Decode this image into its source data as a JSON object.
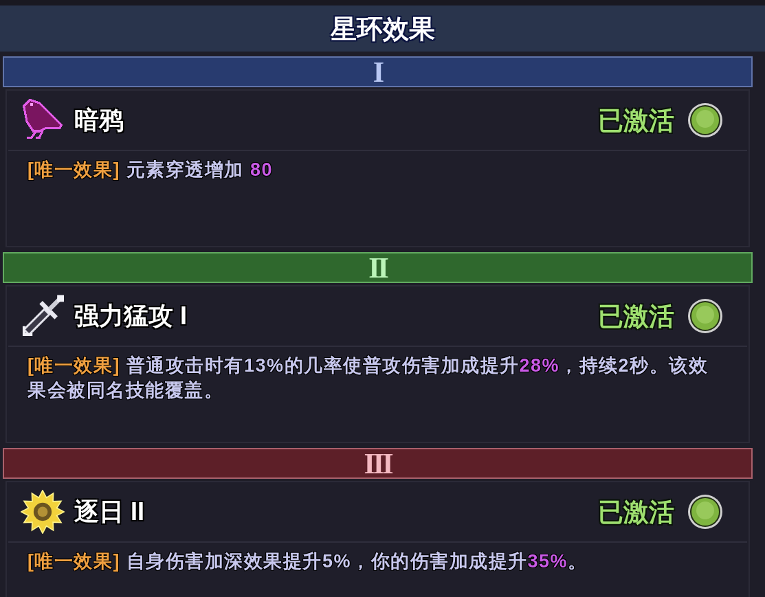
{
  "title": "星环效果",
  "tiers": [
    {
      "numeral": "I",
      "color": "#283b6f",
      "effect": {
        "name": "暗鸦",
        "status": "已激活",
        "active": true,
        "tag": "[唯一效果]",
        "description": "元素穿透增加 **80**"
      }
    },
    {
      "numeral": "II",
      "color": "#2f682d",
      "effect": {
        "name": "强力猛攻 I",
        "status": "已激活",
        "active": true,
        "tag": "[唯一效果]",
        "description": "普通攻击时有13%的几率使普攻伤害加成提升**28%**，持续2秒。该效果会被同名技能覆盖。"
      }
    },
    {
      "numeral": "III",
      "color": "#5d1f28",
      "effect": {
        "name": "逐日 II",
        "status": "已激活",
        "active": true,
        "tag": "[唯一效果]",
        "description": "自身伤害加深效果提升5%，你的伤害加成提升**35%**。"
      }
    }
  ]
}
